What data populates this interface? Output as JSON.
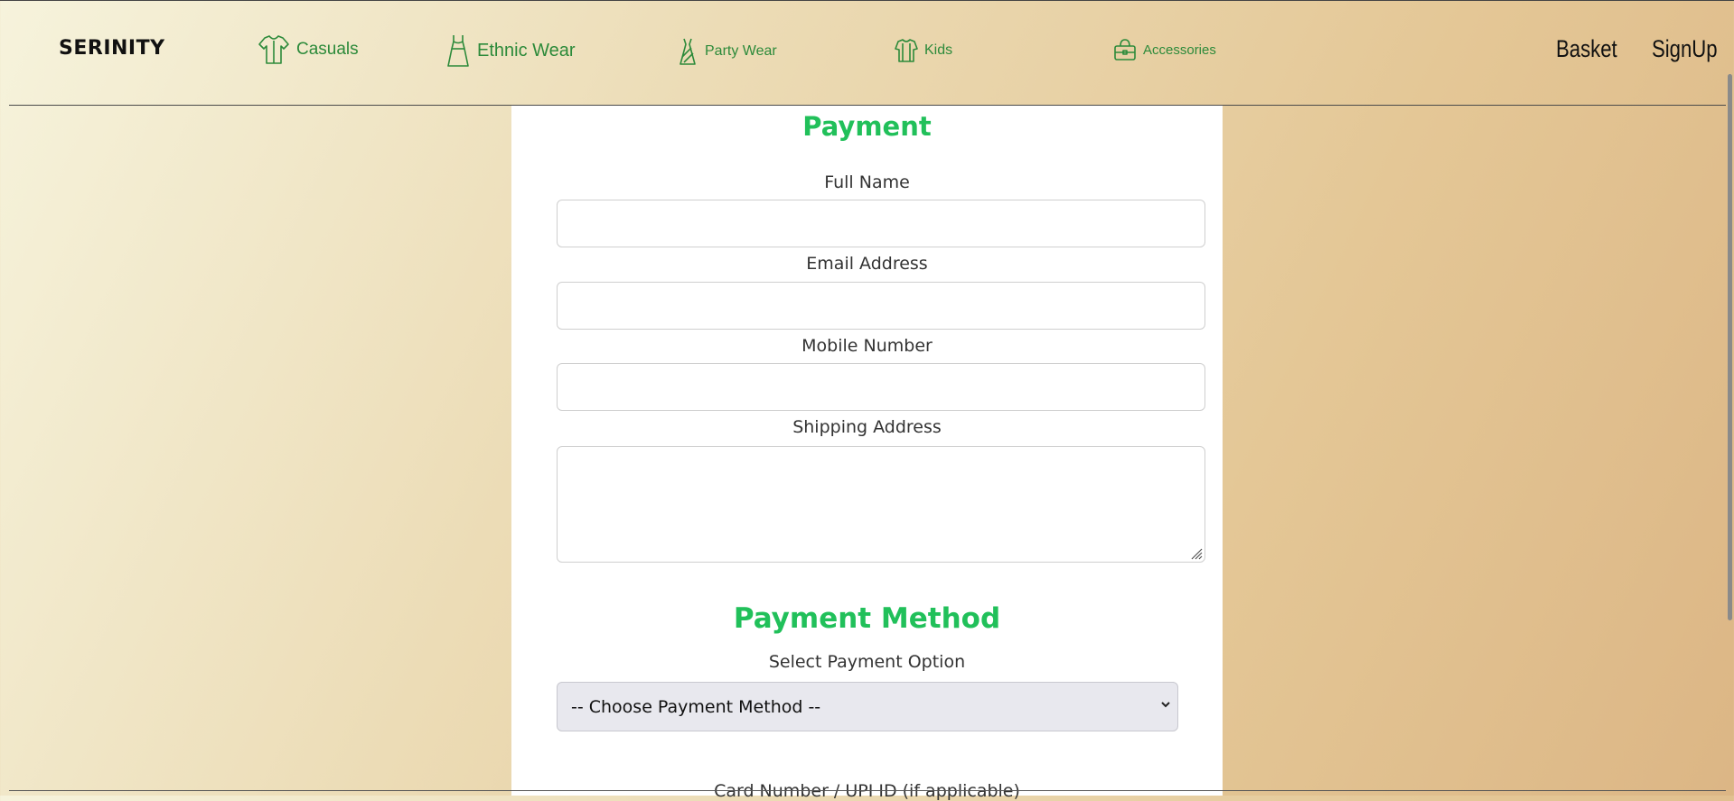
{
  "nav": {
    "brand": "SERINITY",
    "links": [
      {
        "label": "Casuals",
        "icon": "shirt-icon"
      },
      {
        "label": "Ethnic Wear",
        "icon": "dress-icon"
      },
      {
        "label": "Party Wear",
        "icon": "gown-icon"
      },
      {
        "label": "Kids",
        "icon": "kids-shirt-icon"
      },
      {
        "label": "Accessories",
        "icon": "bag-icon"
      }
    ],
    "basket": "Basket",
    "signup": "SignUp",
    "link_color": "#2c8a3a"
  },
  "form": {
    "title": "Payment",
    "full_name_label": "Full Name",
    "email_label": "Email Address",
    "mobile_label": "Mobile Number",
    "address_label": "Shipping Address",
    "method_title": "Payment Method",
    "select_label": "Select Payment Option",
    "select_value": "-- Choose Payment Method --",
    "card_label": "Card Number / UPI ID (if applicable)",
    "accent_color": "#21c05a"
  }
}
